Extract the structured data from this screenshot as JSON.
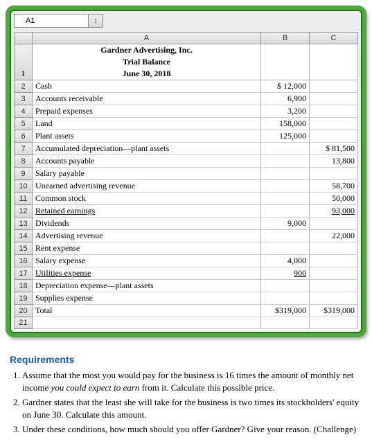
{
  "cellref": "A1",
  "columns": [
    "",
    "A",
    "B",
    "C"
  ],
  "header": {
    "company": "Gardner Advertising, Inc.",
    "report": "Trial Balance",
    "date": "June 30, 2018"
  },
  "rows": [
    {
      "n": "2",
      "a": "Cash",
      "b": "$ 12,000",
      "c": ""
    },
    {
      "n": "3",
      "a": "Accounts receivable",
      "b": "6,900",
      "c": ""
    },
    {
      "n": "4",
      "a": "Prepaid expenses",
      "b": "3,200",
      "c": ""
    },
    {
      "n": "5",
      "a": "Land",
      "b": "158,000",
      "c": ""
    },
    {
      "n": "6",
      "a": "Plant assets",
      "b": "125,000",
      "c": ""
    },
    {
      "n": "7",
      "a": "Accumulated depreciation—plant assets",
      "b": "",
      "c": "$ 81,500"
    },
    {
      "n": "8",
      "a": "Accounts payable",
      "b": "",
      "c": "13,800"
    },
    {
      "n": "9",
      "a": "Salary payable",
      "b": "",
      "c": ""
    },
    {
      "n": "10",
      "a": "Unearned advertising revenue",
      "b": "",
      "c": "58,700"
    },
    {
      "n": "11",
      "a": "Common stock",
      "b": "",
      "c": "50,000"
    },
    {
      "n": "12",
      "a": "Retained earnings",
      "b": "",
      "c": "93,000",
      "ul": true
    },
    {
      "n": "13",
      "a": "Dividends",
      "b": "9,000",
      "c": ""
    },
    {
      "n": "14",
      "a": "Advertising revenue",
      "b": "",
      "c": "22,000"
    },
    {
      "n": "15",
      "a": "Rent expense",
      "b": "",
      "c": ""
    },
    {
      "n": "16",
      "a": "Salary expense",
      "b": "4,000",
      "c": ""
    },
    {
      "n": "17",
      "a": "Utilities expense",
      "b": "900",
      "c": "",
      "ul": true
    },
    {
      "n": "18",
      "a": "Depreciation expense—plant assets",
      "b": "",
      "c": ""
    },
    {
      "n": "19",
      "a": "Supplies expense",
      "b": "",
      "c": ""
    },
    {
      "n": "20",
      "a": "Total",
      "b": "$319,000",
      "c": "$319,000"
    },
    {
      "n": "21",
      "a": "",
      "b": "",
      "c": ""
    }
  ],
  "requirements": {
    "title": "Requirements",
    "items": [
      {
        "pre": "Assume that the most you would pay for the business is 16 times the amount of monthly net income ",
        "em": "you could expect to earn",
        "post": " from it. Calculate this possible price."
      },
      {
        "pre": "Gardner states that the least she will take for the business is two times its stockholders' equity on June 30. Calculate this amount.",
        "em": "",
        "post": ""
      },
      {
        "pre": "Under these conditions, how much should you offer Gardner? Give your reason. (Challenge)",
        "em": "",
        "post": ""
      }
    ]
  },
  "chart_data": {
    "type": "table",
    "title": "Gardner Advertising, Inc. — Trial Balance — June 30, 2018",
    "columns": [
      "Account",
      "Debit",
      "Credit"
    ],
    "rows": [
      [
        "Cash",
        12000,
        null
      ],
      [
        "Accounts receivable",
        6900,
        null
      ],
      [
        "Prepaid expenses",
        3200,
        null
      ],
      [
        "Land",
        158000,
        null
      ],
      [
        "Plant assets",
        125000,
        null
      ],
      [
        "Accumulated depreciation—plant assets",
        null,
        81500
      ],
      [
        "Accounts payable",
        null,
        13800
      ],
      [
        "Salary payable",
        null,
        null
      ],
      [
        "Unearned advertising revenue",
        null,
        58700
      ],
      [
        "Common stock",
        null,
        50000
      ],
      [
        "Retained earnings",
        null,
        93000
      ],
      [
        "Dividends",
        9000,
        null
      ],
      [
        "Advertising revenue",
        null,
        22000
      ],
      [
        "Rent expense",
        null,
        null
      ],
      [
        "Salary expense",
        4000,
        null
      ],
      [
        "Utilities expense",
        900,
        null
      ],
      [
        "Depreciation expense—plant assets",
        null,
        null
      ],
      [
        "Supplies expense",
        null,
        null
      ],
      [
        "Total",
        319000,
        319000
      ]
    ]
  }
}
